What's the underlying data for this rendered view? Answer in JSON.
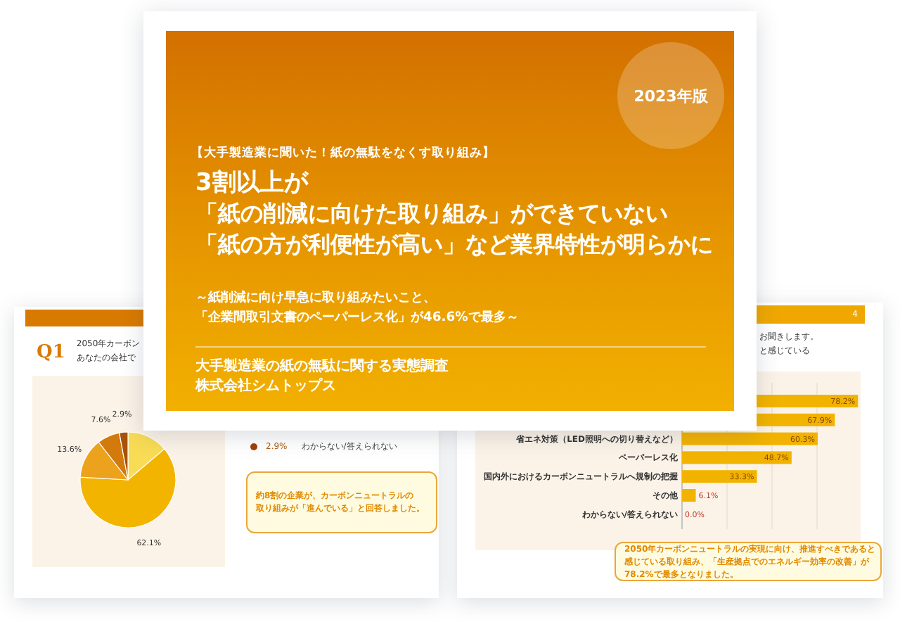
{
  "cover": {
    "edition_badge": "2023年版",
    "kicker": "【大手製造業に聞いた！紙の無駄をなくす取り組み】",
    "headline": [
      "3割以上が",
      "「紙の削減に向けた取り組み」ができていない",
      "「紙の方が利便性が高い」など業界特性が明らかに"
    ],
    "subheadline": [
      "～紙削減に向け早急に取り組みたいこと、",
      "「企業間取引文書のペーパーレス化」が46.6%で最多～"
    ],
    "survey_title": "大手製造業の紙の無駄に関する実態調査",
    "company": "株式会社シムトップス"
  },
  "page_left": {
    "question_number": "Q1",
    "question_lines": [
      "2050年カーボン",
      "あなたの会社で"
    ],
    "chart_data": {
      "type": "pie",
      "values": [
        13.8,
        62.1,
        13.6,
        7.6,
        2.9
      ],
      "value_labels": [
        null,
        "62.1%",
        "13.6%",
        "7.6%",
        "2.9%"
      ]
    },
    "legend": [
      {
        "value": "2.9%",
        "label": "わからない/答えられない",
        "color": "#a0400a"
      }
    ],
    "callout_lines": [
      "約8割の企業が、カーボンニュートラルの",
      "取り組みが「進んでいる」と回答しました。"
    ]
  },
  "page_right": {
    "page_number": "4",
    "question_lines": [
      "お聞きします。",
      "と感じている"
    ],
    "chart_data": {
      "type": "bar",
      "orientation": "horizontal",
      "categories": [
        null,
        null,
        "省エネ対策（LED照明への切り替えなど）",
        "ペーパーレス化",
        "国内外におけるカーボンニュートラルへ規制の把握",
        "その他",
        "わからない/答えられない"
      ],
      "values": [
        78.2,
        67.9,
        60.3,
        48.7,
        33.3,
        6.1,
        0.0
      ],
      "value_labels": [
        "78.2%",
        "67.9%",
        "60.3%",
        "48.7%",
        "33.3%",
        "6.1%",
        "0.0%"
      ]
    },
    "callout_lines": [
      "2050年カーボンニュートラルの実現に向け、推進すべきであると",
      "感じている取り組み、「生産拠点でのエネルギー効率の改善」が",
      "78.2%で最多となりました。"
    ]
  }
}
